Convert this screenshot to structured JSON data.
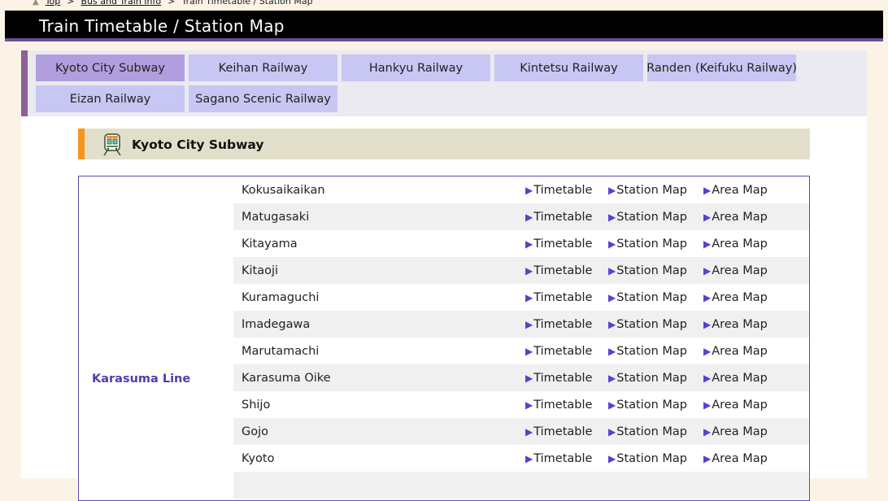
{
  "breadcrumb": {
    "items": [
      "Top",
      "Bus and Train Info",
      "Train Timetable / Station Map"
    ],
    "separator": ">"
  },
  "header": {
    "title": "Train Timetable / Station Map"
  },
  "tabs": [
    {
      "label": "Kyoto City Subway",
      "active": true
    },
    {
      "label": "Keihan Railway",
      "active": false
    },
    {
      "label": "Hankyu Railway",
      "active": false
    },
    {
      "label": "Kintetsu Railway",
      "active": false
    },
    {
      "label": "Randen (Keifuku Railway)",
      "active": false
    },
    {
      "label": "Eizan Railway",
      "active": false
    },
    {
      "label": "Sagano Scenic Railway",
      "active": false
    }
  ],
  "section": {
    "title": "Kyoto City Subway",
    "icon": "train-icon"
  },
  "line": {
    "name": "Karasuma Line",
    "link_labels": {
      "timetable": "Timetable",
      "station_map": "Station Map",
      "area_map": "Area Map"
    },
    "stations": [
      "Kokusaikaikan",
      "Matugasaki",
      "Kitayama",
      "Kitaoji",
      "Kuramaguchi",
      "Imadegawa",
      "Marutamachi",
      "Karasuma Oike",
      "Shijo",
      "Gojo",
      "Kyoto",
      ""
    ]
  },
  "colors": {
    "title_bar": "#000000",
    "title_accent": "#6a5196",
    "tab": "#c8c6f2",
    "tab_active": "#b19ede",
    "section_accent": "#f7941d",
    "link_arrow": "#5a3fd1",
    "line_name": "#4a3fb0"
  }
}
